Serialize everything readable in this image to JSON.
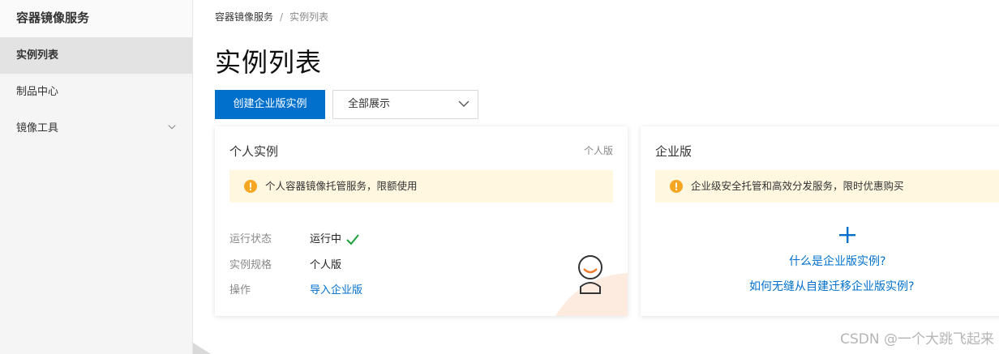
{
  "sidebar": {
    "title": "容器镜像服务",
    "items": [
      {
        "label": "实例列表",
        "active": true
      },
      {
        "label": "制品中心",
        "active": false
      },
      {
        "label": "镜像工具",
        "active": false,
        "icon": "chevron-down-icon"
      }
    ]
  },
  "breadcrumb": {
    "root": "容器镜像服务",
    "separator": "/",
    "current": "实例列表"
  },
  "page": {
    "title": "实例列表"
  },
  "toolbar": {
    "create_label": "创建企业版实例",
    "filter_value": "全部展示"
  },
  "cards": {
    "personal": {
      "title": "个人实例",
      "tag": "个人版",
      "notice": "个人容器镜像托管服务，限额使用",
      "rows": [
        {
          "label": "运行状态",
          "value": "运行中"
        },
        {
          "label": "实例规格",
          "value": "个人版"
        },
        {
          "label": "操作",
          "value": "导入企业版"
        }
      ]
    },
    "enterprise": {
      "title": "企业版",
      "notice": "企业级安全托管和高效分发服务，限时优惠购买",
      "link_1": "什么是企业版实例?",
      "link_2": "如何无缝从自建迁移企业版实例?"
    }
  },
  "watermark": "CSDN @一个大跳飞起来",
  "colors": {
    "primary": "#0070cc",
    "notice_bg": "#fff7e0",
    "warning": "#f5a623",
    "success": "#1e9e3a"
  }
}
